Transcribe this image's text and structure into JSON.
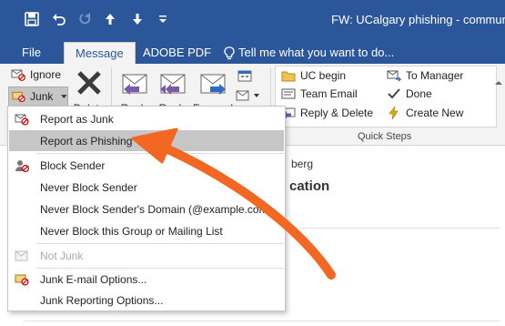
{
  "window": {
    "title": "FW: UCalgary phishing - commun"
  },
  "tabs": [
    {
      "label": "File"
    },
    {
      "label": "Message"
    },
    {
      "label": "ADOBE PDF"
    }
  ],
  "tell_me": {
    "text": "Tell me what you want to do..."
  },
  "ribbon": {
    "ignore": "Ignore",
    "junk": "Junk",
    "delete": "Delete",
    "reply": "Reply",
    "reply_all": "Reply",
    "forward": "Forward"
  },
  "quick_steps": {
    "group_label": "Quick Steps",
    "items": [
      {
        "label": "UC begin"
      },
      {
        "label": "Team Email"
      },
      {
        "label": "Reply & Delete"
      },
      {
        "label": "To Manager"
      },
      {
        "label": "Done"
      },
      {
        "label": "Create New"
      }
    ]
  },
  "reading_pane": {
    "sender_fragment": "berg",
    "subject_fragment": "cation"
  },
  "junk_menu": {
    "items": [
      {
        "label": "Report as Junk",
        "icon": "report-junk-icon"
      },
      {
        "label": "Report as Phishing",
        "icon": "none"
      },
      {
        "label": "Block Sender",
        "icon": "block-sender-icon"
      },
      {
        "label": "Never Block Sender",
        "icon": "none"
      },
      {
        "label": "Never Block Sender's Domain (@example.com)",
        "icon": "none"
      },
      {
        "label": "Never Block this Group or Mailing List",
        "icon": "none"
      },
      {
        "label": "Not Junk",
        "icon": "not-junk-icon"
      },
      {
        "label": "Junk E-mail Options...",
        "icon": "junk-options-icon"
      },
      {
        "label": "Junk Reporting Options...",
        "icon": "none"
      }
    ],
    "highlighted_item": "Report as Phishing"
  },
  "colors": {
    "titlebar": "#2b579a",
    "ribbon": "#f3f3f3",
    "menu_highlight": "#c6c6c6",
    "annotation_arrow": "#f26722"
  }
}
